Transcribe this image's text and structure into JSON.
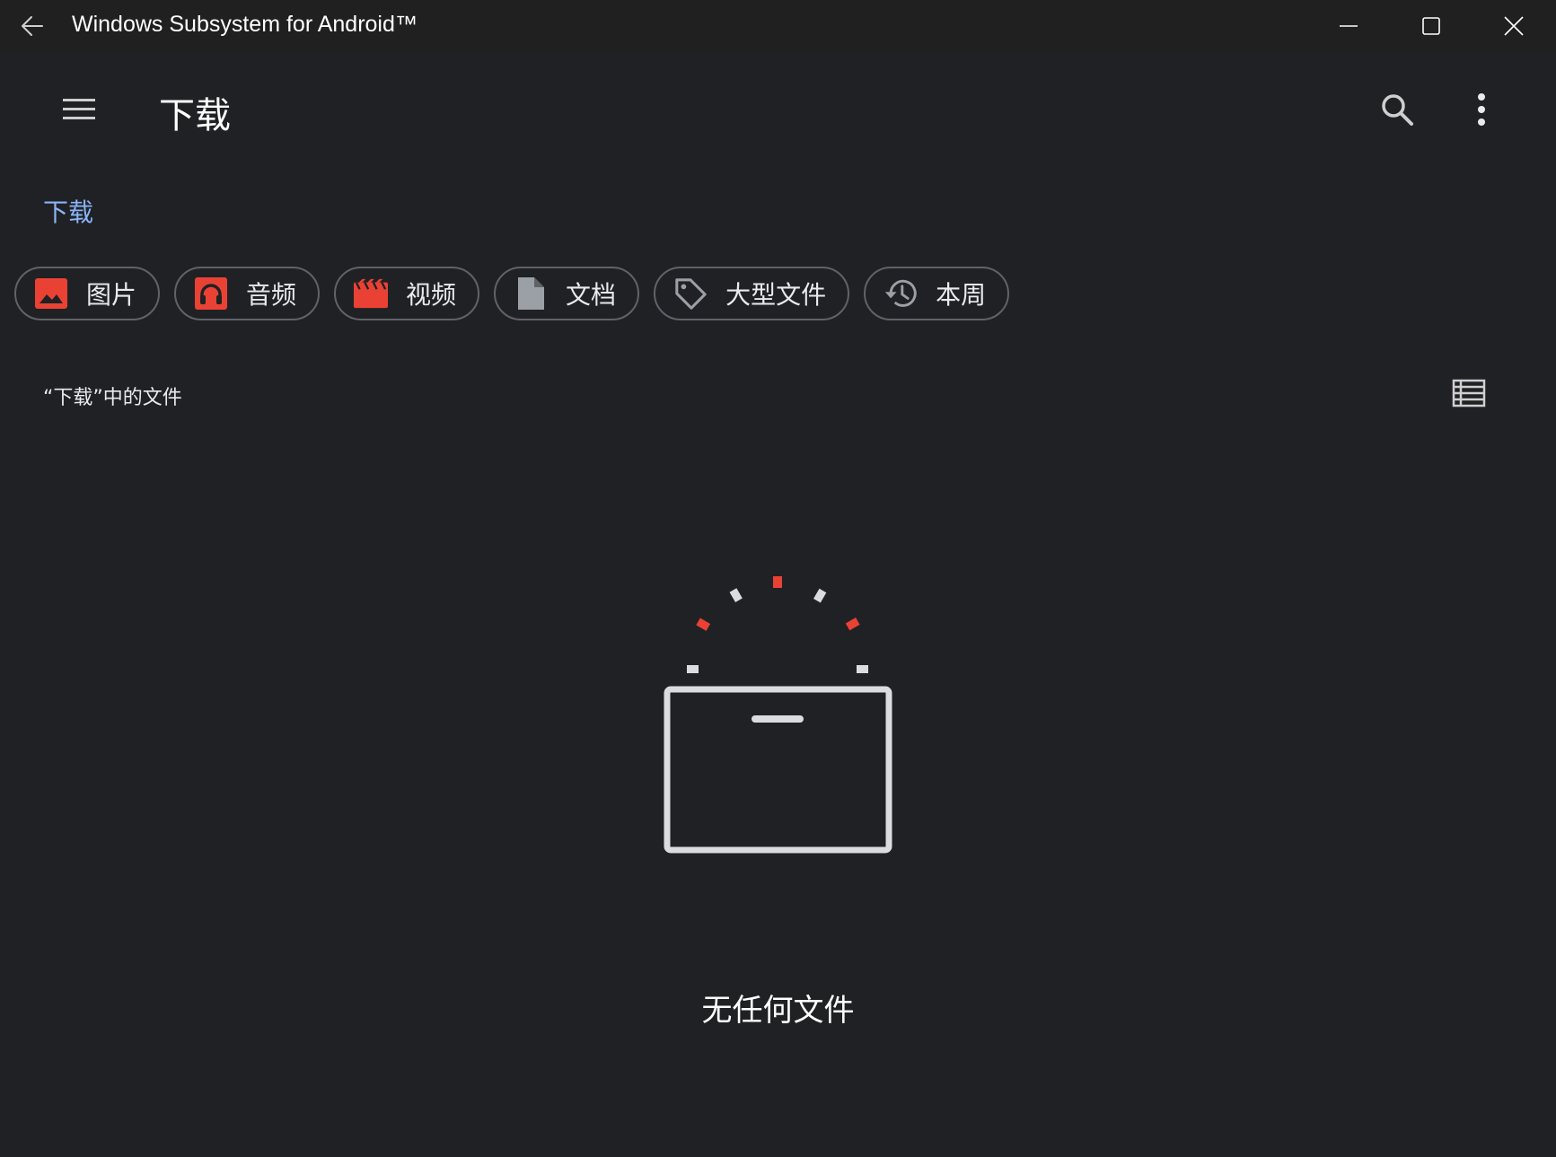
{
  "window": {
    "title": "Windows Subsystem for Android™"
  },
  "appbar": {
    "title": "下载"
  },
  "breadcrumb": {
    "current": "下载"
  },
  "chips": [
    {
      "label": "图片",
      "icon": "image-icon",
      "color": "#e94235"
    },
    {
      "label": "音频",
      "icon": "headphones-icon",
      "color": "#e94235"
    },
    {
      "label": "视频",
      "icon": "movie-icon",
      "color": "#e94235"
    },
    {
      "label": "文档",
      "icon": "document-icon",
      "color": "#9aa0a6"
    },
    {
      "label": "大型文件",
      "icon": "tag-icon",
      "color": "#9aa0a6"
    },
    {
      "label": "本周",
      "icon": "history-icon",
      "color": "#9aa0a6"
    }
  ],
  "section": {
    "title": "“下载”中的文件"
  },
  "empty_state": {
    "message": "无任何文件"
  },
  "colors": {
    "background": "#202124",
    "titlebar": "#202020",
    "accent": "#8ab4f8",
    "red": "#e94235"
  }
}
